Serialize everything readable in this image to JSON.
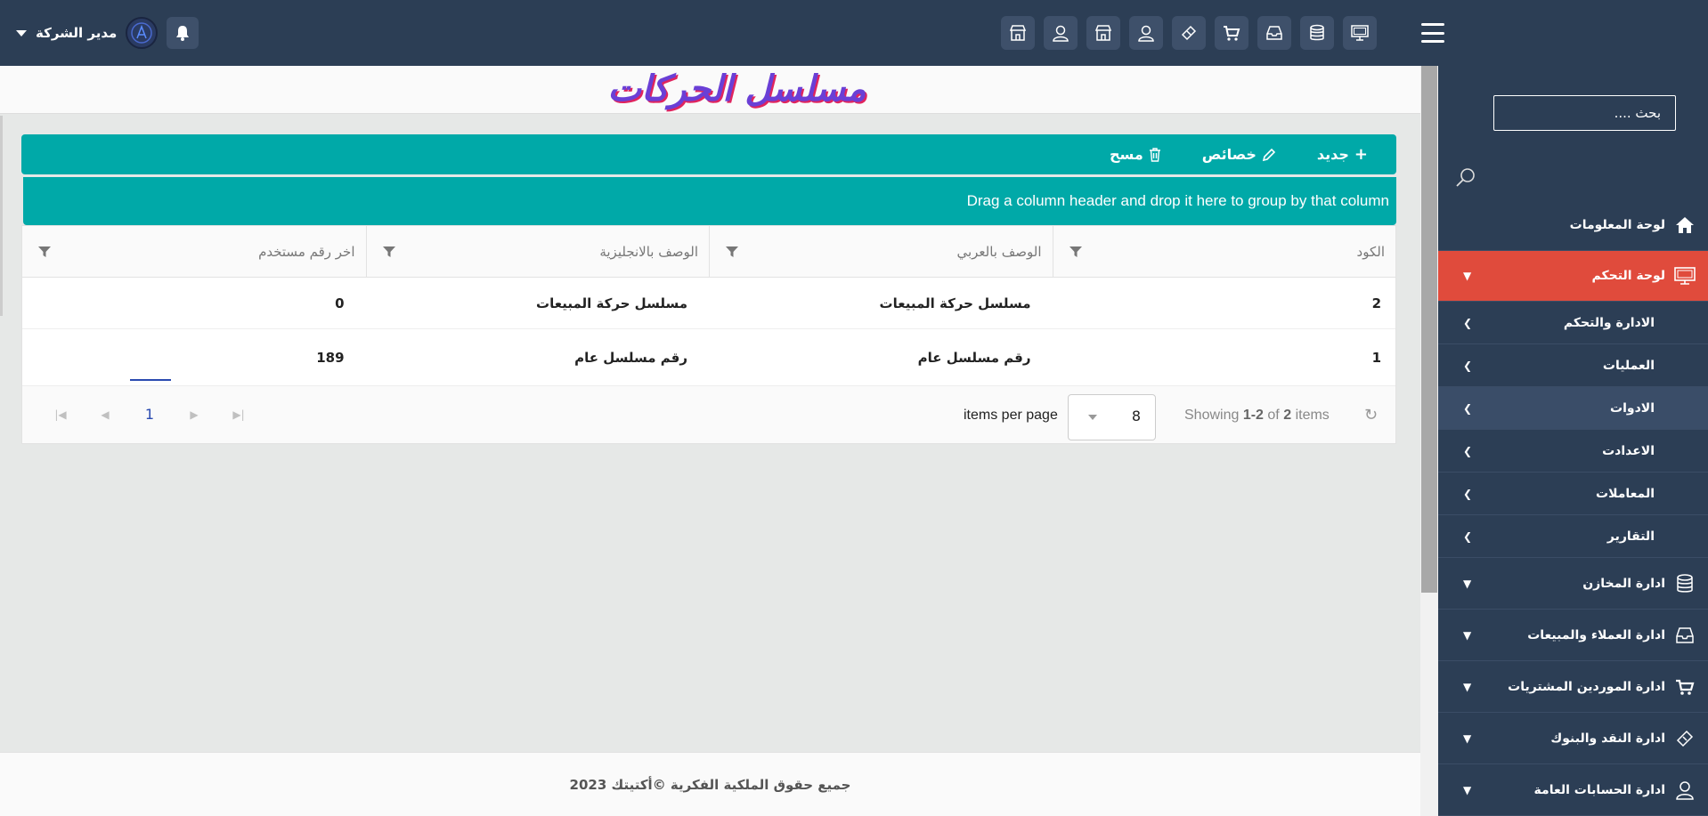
{
  "topbar": {
    "user_name": "مدير الشركة",
    "tool_icons": [
      "monitor-icon",
      "database-icon",
      "inbox-icon",
      "cart-icon",
      "ticket-icon",
      "user-icon",
      "store-icon",
      "user-icon",
      "store-icon"
    ]
  },
  "page": {
    "title": "مسلسل الحركات"
  },
  "toolbar": {
    "new_label": "جديد",
    "props_label": "خصائص",
    "delete_label": "مسح"
  },
  "grid": {
    "group_hint": "Drag a column header and drop it here to group by that column",
    "columns": [
      "الكود",
      "الوصف بالعربي",
      "الوصف بالانجليزية",
      "اخر رقم مستخدم"
    ],
    "rows": [
      [
        "2",
        "مسلسل حركة المبيعات",
        "مسلسل حركة المبيعات",
        "0"
      ],
      [
        "1",
        "رقم مسلسل عام",
        "رقم مسلسل عام",
        "189"
      ]
    ]
  },
  "pager": {
    "current_page": "1",
    "items_per_page_label": "items per page",
    "items_per_page_value": "8",
    "showing_prefix": "Showing",
    "showing_range": "1-2",
    "showing_of": "of",
    "showing_total": "2",
    "showing_suffix": "items"
  },
  "footer": {
    "copyright": "جميع حقوق الملكية الفكرية ©أكتيتك 2023"
  },
  "sidebar": {
    "search_placeholder": "بحث ....",
    "items": [
      {
        "label": "لوحة المعلومات",
        "icon": "home-icon"
      },
      {
        "label": "لوحة التحكم",
        "icon": "monitor-icon",
        "active": true
      },
      {
        "label": "الادارة والتحكم"
      },
      {
        "label": "العمليات"
      },
      {
        "label": "الادوات",
        "hover": true
      },
      {
        "label": "الاعدادت"
      },
      {
        "label": "المعاملات"
      },
      {
        "label": "التقارير"
      },
      {
        "label": "ادارة المخازن",
        "icon": "database-icon"
      },
      {
        "label": "ادارة العملاء والمبيعات",
        "icon": "inbox-icon"
      },
      {
        "label": "ادارة الموردين المشتريات",
        "icon": "cart-icon"
      },
      {
        "label": "ادارة النقد والبنوك",
        "icon": "ticket-icon"
      },
      {
        "label": "ادارة الحسابات العامة",
        "icon": "user-icon"
      }
    ]
  }
}
